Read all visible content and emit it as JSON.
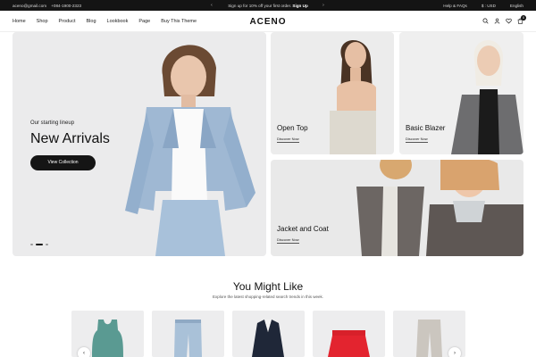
{
  "topbar": {
    "email": "aceno@gmail.com",
    "phone": "+084-1900-2323",
    "promo_text": "Sign up for 10% off your first order.",
    "promo_link": "Sign Up",
    "prev_arrow": "‹",
    "next_arrow": "›",
    "help": "Help & FAQs",
    "currency": "$ : USD",
    "language": "English"
  },
  "header": {
    "logo": "ACENO",
    "nav": [
      "Home",
      "Shop",
      "Product",
      "Blog",
      "Lookbook",
      "Page",
      "Buy This Theme"
    ],
    "cart_count": "0"
  },
  "hero": {
    "kicker": "Our starting lineup",
    "title": "New Arrivals",
    "button": "View Collection"
  },
  "tiles": [
    {
      "title": "Open Top",
      "link": "Discover Now"
    },
    {
      "title": "Basic Blazer",
      "link": "Discover Now"
    },
    {
      "title": "Jacket and Coat",
      "link": "Discover Now"
    }
  ],
  "section": {
    "title": "You Might Like",
    "subtitle": "Explore the latest shopping-related search trends in this week.",
    "prev": "‹",
    "next": "›"
  },
  "icons": [
    "search-icon",
    "user-icon",
    "heart-icon",
    "cart-icon"
  ]
}
